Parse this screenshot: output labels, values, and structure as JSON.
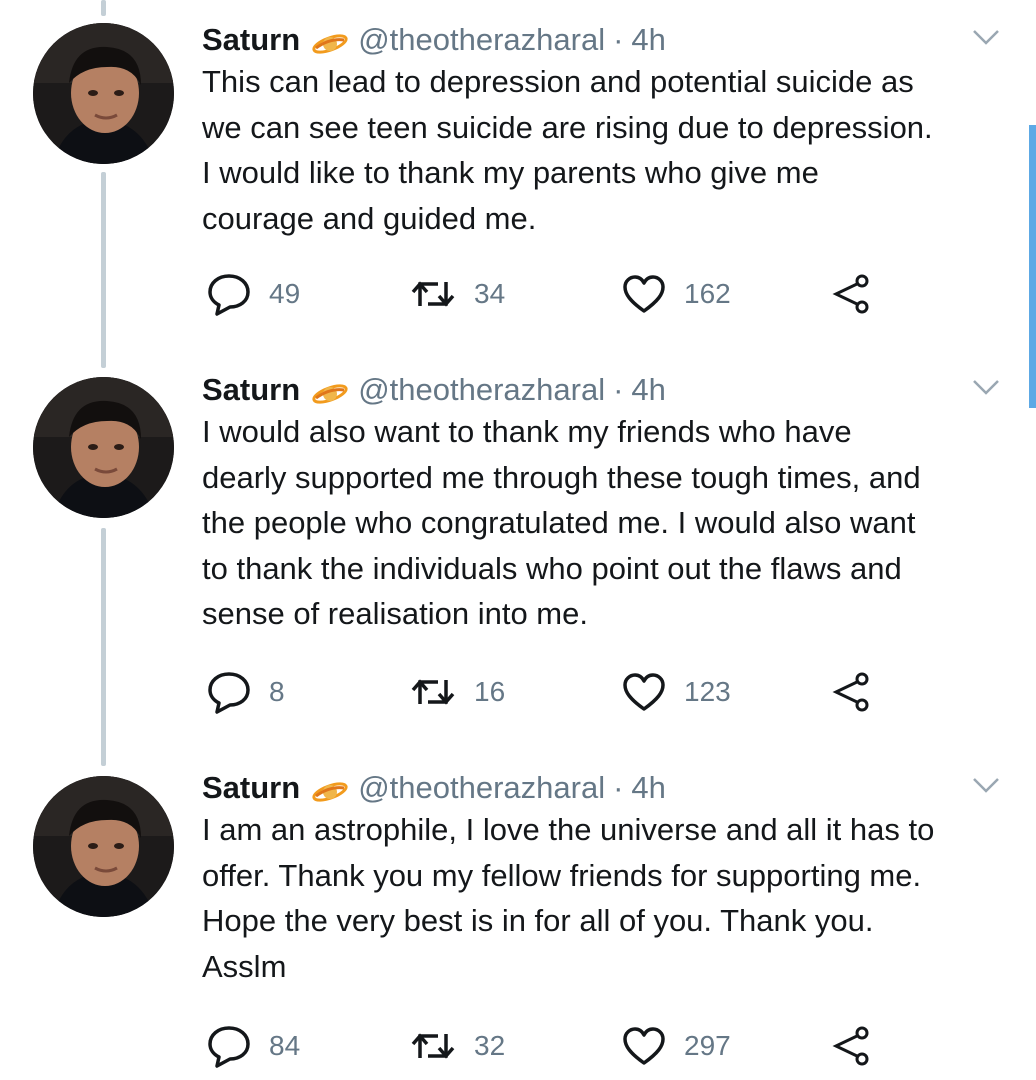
{
  "tweets": [
    {
      "name": "Saturn",
      "handle": "@theotherazharal",
      "separator": "·",
      "time": "4h",
      "text": "This can lead to depression and potential suicide as\nwe can see teen suicide are rising due to depression.\nI would like to thank my parents who give me\ncourage and guided me.",
      "replies": "49",
      "retweets": "34",
      "likes": "162"
    },
    {
      "name": "Saturn",
      "handle": "@theotherazharal",
      "separator": "·",
      "time": "4h",
      "text": "I would also want to thank my friends who have\ndearly supported me through these tough times, and\nthe people who congratulated me. I would also want\nto thank the individuals who point out the flaws and\nsense of realisation into me.",
      "replies": "8",
      "retweets": "16",
      "likes": "123"
    },
    {
      "name": "Saturn",
      "handle": "@theotherazharal",
      "separator": "·",
      "time": "4h",
      "text": "I am an astrophile, I love the universe and all it has to\noffer. Thank you my fellow friends for supporting me.\nHope the very best is in for all of you. Thank you.\nAsslm",
      "replies": "84",
      "retweets": "32",
      "likes": "297"
    }
  ],
  "icons": {
    "badge": "ringed-planet-icon",
    "caret": "chevron-down-icon",
    "reply": "reply-icon",
    "retweet": "retweet-icon",
    "like": "heart-icon",
    "share": "share-icon"
  },
  "colors": {
    "text": "#14171a",
    "secondary": "#657786",
    "thread_line": "#c4cfd6",
    "scrollbar": "#5da9e5",
    "badge_orange": "#f29b1d"
  }
}
